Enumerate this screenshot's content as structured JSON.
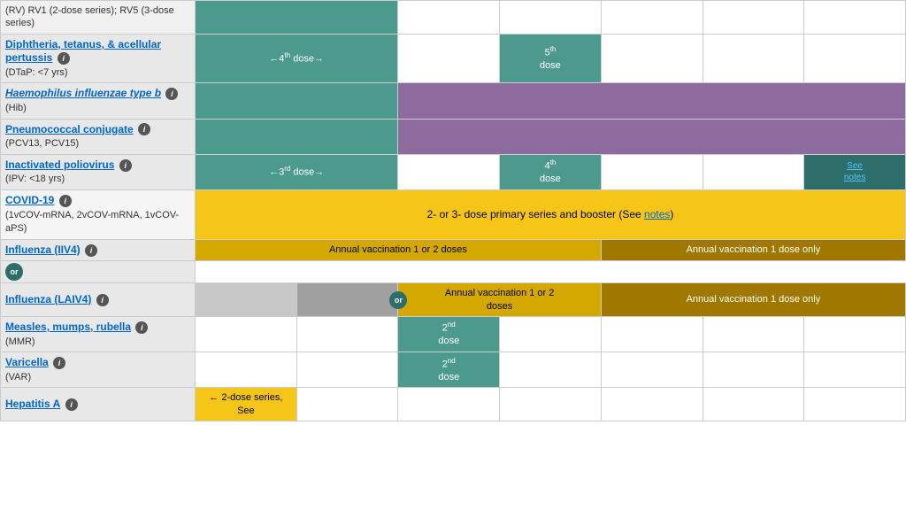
{
  "rows": [
    {
      "id": "intro",
      "vaccine": "(RV) RV1 (2-dose series); RV5 (3-dose series)",
      "isIntro": true
    },
    {
      "id": "dtap",
      "vaccineName": "Diphtheria, tetanus, & acellular pertussis",
      "vaccineNameStyle": "link",
      "vaccineSub": "(DTaP: <7 yrs)",
      "hasInfo": true,
      "cells": [
        {
          "type": "teal",
          "text": "←4th dose→",
          "span": 2
        },
        {
          "type": "white"
        },
        {
          "type": "teal",
          "text": "5th\ndose",
          "span": 1
        },
        {
          "type": "white"
        },
        {
          "type": "white"
        },
        {
          "type": "white"
        },
        {
          "type": "white"
        }
      ]
    },
    {
      "id": "hib",
      "vaccineName": "Haemophilus influenzae type b",
      "vaccineNameStyle": "italic-link",
      "vaccineSub": "(Hib)",
      "hasInfo": true,
      "cells": [
        {
          "type": "teal",
          "span": 2
        },
        {
          "type": "purple",
          "span": 5
        }
      ]
    },
    {
      "id": "pcv",
      "vaccineName": "Pneumococcal conjugate",
      "vaccineNameStyle": "link",
      "vaccineSub": "(PCV13, PCV15)",
      "hasInfo": true,
      "cells": [
        {
          "type": "teal",
          "span": 2
        },
        {
          "type": "purple",
          "span": 5
        }
      ]
    },
    {
      "id": "ipv",
      "vaccineName": "Inactivated poliovirus",
      "vaccineNameStyle": "link",
      "vaccineSub": "(IPV: <18 yrs)",
      "hasInfo": true,
      "cells": [
        {
          "type": "teal",
          "text": "←3rd dose→",
          "span": 2
        },
        {
          "type": "white"
        },
        {
          "type": "teal",
          "text": "4th\ndose"
        },
        {
          "type": "white"
        },
        {
          "type": "white"
        },
        {
          "type": "white"
        },
        {
          "type": "teal-dark-see-notes"
        }
      ]
    },
    {
      "id": "covid",
      "vaccineName": "COVID-19",
      "vaccineNameStyle": "link",
      "vaccineSub": "(1vCOV-mRNA, 2vCOV-mRNA, 1vCOV-aPS)",
      "hasInfo": true,
      "cells": [
        {
          "type": "yellow-full",
          "text": "2- or 3- dose primary series and booster (See notes)",
          "span": 7
        }
      ]
    },
    {
      "id": "fluiiv",
      "vaccineName": "Influenza (IIV4)",
      "vaccineNameStyle": "link",
      "hasInfo": true,
      "cells": [
        {
          "type": "yellow",
          "text": "Annual vaccination 1 or 2 doses",
          "span": 4
        },
        {
          "type": "yellow-dark",
          "text": "Annual vaccination 1 dose only",
          "span": 3
        }
      ]
    },
    {
      "id": "flulaiv",
      "vaccineName": "Influenza (LAIV4)",
      "vaccineNameStyle": "link",
      "hasInfo": true,
      "isOrRow": true,
      "cells": [
        {
          "type": "gray-light"
        },
        {
          "type": "gray-medium"
        },
        {
          "type": "yellow",
          "text": "Annual vaccination 1 or 2\ndoses",
          "span": 2,
          "orBadge": true
        },
        {
          "type": "yellow-dark",
          "text": "Annual vaccination 1 dose only",
          "span": 3
        }
      ]
    },
    {
      "id": "mmr",
      "vaccineName": "Measles, mumps, rubella",
      "vaccineNameStyle": "link",
      "vaccineSub": "(MMR)",
      "hasInfo": true,
      "cells": [
        {
          "type": "white"
        },
        {
          "type": "white"
        },
        {
          "type": "teal",
          "text": "2nd\ndose"
        },
        {
          "type": "white"
        },
        {
          "type": "white"
        },
        {
          "type": "white"
        },
        {
          "type": "white"
        }
      ]
    },
    {
      "id": "varicella",
      "vaccineName": "Varicella",
      "vaccineNameStyle": "link",
      "vaccineSub": "(VAR)",
      "hasInfo": true,
      "cells": [
        {
          "type": "white"
        },
        {
          "type": "white"
        },
        {
          "type": "teal",
          "text": "2nd\ndose"
        },
        {
          "type": "white"
        },
        {
          "type": "white"
        },
        {
          "type": "white"
        },
        {
          "type": "white"
        }
      ]
    },
    {
      "id": "hepa",
      "vaccineName": "Hepatitis A",
      "vaccineNameStyle": "link",
      "hasInfo": true,
      "cells": [
        {
          "type": "yellow-dose",
          "text": "← 2-dose series, See"
        },
        {
          "type": "white",
          "span": 6
        }
      ]
    }
  ],
  "labels": {
    "see_notes": "See\nnotes",
    "covid_booster": "2- or 3- dose primary series and booster (See notes)",
    "notes_link": "notes",
    "or_text": "or",
    "hepa_dose": "← 2-dose series, See"
  }
}
